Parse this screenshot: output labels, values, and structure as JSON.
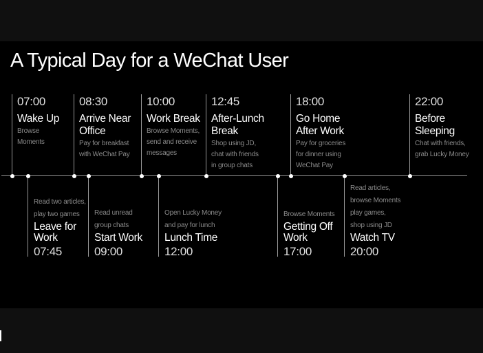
{
  "title": "A Typical Day for a WeChat User",
  "colors": {
    "background": "#000000",
    "outer": "#101010",
    "line": "#9a9a9a",
    "text": "#ffffff",
    "description": "#8a8a8a"
  },
  "above": [
    {
      "time": "07:00",
      "heading": [
        "Wake Up"
      ],
      "description": [
        "Browse",
        "Moments"
      ]
    },
    {
      "time": "08:30",
      "heading": [
        "Arrive Near",
        "Office"
      ],
      "description": [
        "Pay for breakfast",
        "with WeChat Pay"
      ]
    },
    {
      "time": "10:00",
      "heading": [
        "Work Break"
      ],
      "description": [
        "Browse Moments,",
        "send and receive",
        "messages"
      ]
    },
    {
      "time": "12:45",
      "heading": [
        "After-Lunch",
        "Break"
      ],
      "description": [
        "Shop using JD,",
        "chat with friends",
        "in group chats"
      ]
    },
    {
      "time": "18:00",
      "heading": [
        "Go Home",
        "After Work"
      ],
      "description": [
        "Pay for groceries",
        "for dinner using",
        "WeChat Pay"
      ]
    },
    {
      "time": "22:00",
      "heading": [
        "Before",
        "Sleeping"
      ],
      "description": [
        "Chat with friends,",
        "grab Lucky Money"
      ]
    }
  ],
  "below": [
    {
      "time": "07:45",
      "heading": [
        "Leave for",
        "Work"
      ],
      "description": [
        "Read two articles,",
        "play two games"
      ]
    },
    {
      "time": "09:00",
      "heading": [
        "Start Work"
      ],
      "description": [
        "Read unread",
        "group chats"
      ]
    },
    {
      "time": "12:00",
      "heading": [
        "Lunch Time"
      ],
      "description": [
        "Open Lucky Money",
        "and pay for lunch"
      ]
    },
    {
      "time": "17:00",
      "heading": [
        "Getting Off",
        "Work"
      ],
      "description": [
        "Browse Moments"
      ]
    },
    {
      "time": "20:00",
      "heading": [
        "Watch TV"
      ],
      "description": [
        "Read articles,",
        "browse Moments",
        "play games,",
        "shop using JD"
      ]
    }
  ]
}
